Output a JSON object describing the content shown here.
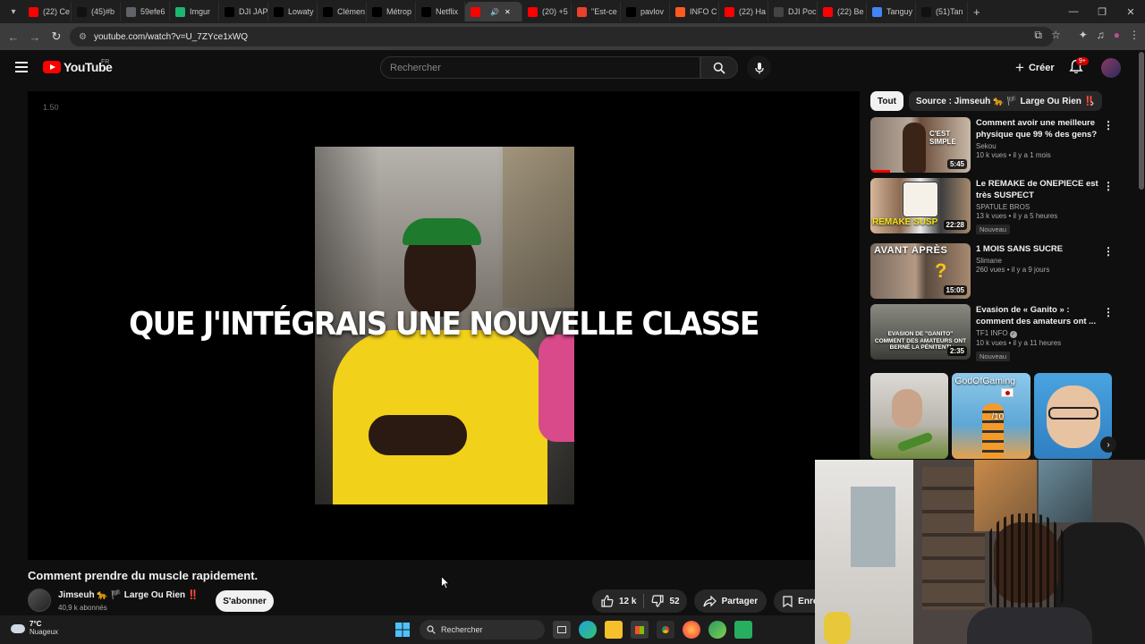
{
  "browser": {
    "tabs": [
      {
        "label": "(22) Ce",
        "fav_color": "#ff0000",
        "icon": "youtube-icon"
      },
      {
        "label": "(45)#b",
        "fav_color": "#111111",
        "icon": "tiktok-icon"
      },
      {
        "label": "59efe6",
        "fav_color": "#5f6368",
        "icon": "globe-icon"
      },
      {
        "label": "Imgur",
        "fav_color": "#1bb76e",
        "icon": "imgur-icon"
      },
      {
        "label": "DJI JAP",
        "fav_color": "#000000",
        "icon": "x-icon"
      },
      {
        "label": "Lowaty",
        "fav_color": "#000000",
        "icon": "x-icon"
      },
      {
        "label": "Clémen",
        "fav_color": "#000000",
        "icon": "x-icon"
      },
      {
        "label": "Métrop",
        "fav_color": "#000000",
        "icon": "x-icon"
      },
      {
        "label": "Netflix",
        "fav_color": "#000000",
        "icon": "x-icon"
      },
      {
        "label": "",
        "fav_color": "#ff0000",
        "icon": "youtube-icon",
        "active": true
      },
      {
        "label": "(20) +5",
        "fav_color": "#ff0000",
        "icon": "youtube-icon"
      },
      {
        "label": "\"Est-ce",
        "fav_color": "#e8412c",
        "icon": "e-icon"
      },
      {
        "label": "pavlov",
        "fav_color": "#000000",
        "icon": "x-icon"
      },
      {
        "label": "INFO C",
        "fav_color": "#ff5a1f",
        "icon": "rss-icon"
      },
      {
        "label": "(22) Ha",
        "fav_color": "#ff0000",
        "icon": "youtube-icon"
      },
      {
        "label": "DJI Poc",
        "fav_color": "#444444",
        "icon": "dji-icon"
      },
      {
        "label": "(22) Be",
        "fav_color": "#ff0000",
        "icon": "youtube-icon"
      },
      {
        "label": "Tanguy",
        "fav_color": "#4285f4",
        "icon": "google-icon"
      },
      {
        "label": "(51)Tan",
        "fav_color": "#111111",
        "icon": "tiktok-icon"
      }
    ],
    "new_tab": "+",
    "url": "youtube.com/watch?v=U_7ZYce1xWQ"
  },
  "header": {
    "logo_text": "YouTube",
    "region": "FR",
    "search_placeholder": "Rechercher",
    "create_label": "Créer",
    "notif_badge": "9+"
  },
  "player": {
    "speed_label": "1.50",
    "caption": "QUE J'INTÉGRAIS UNE NOUVELLE CLASSE"
  },
  "video": {
    "title": "Comment prendre du muscle rapidement.",
    "channel": "Jimseuh 🐆 🏴 Large Ou Rien ‼️",
    "subscribers": "40,9 k abonnés",
    "subscribe_label": "S'abonner",
    "likes": "12 k",
    "dislikes": "52",
    "share_label": "Partager",
    "save_label": "Enregist"
  },
  "sidebar": {
    "chips": [
      {
        "label": "Tout",
        "selected": true
      },
      {
        "label": "Source : Jimseuh 🐆 🏴 Large Ou Rien ‼️",
        "selected": false
      }
    ],
    "recommendations": [
      {
        "title": "Comment avoir une meilleure physique que 99 % des gens?",
        "channel": "Sekou",
        "meta": "10 k vues • il y a 1 mois",
        "duration": "5:45",
        "badge": "",
        "thumb_text": "C'EST SIMPLE",
        "watched": 0.2
      },
      {
        "title": "Le REMAKE de ONEPIECE est très SUSPECT",
        "channel": "SPATULE BROS",
        "meta": "13 k vues • il y a 5 heures",
        "duration": "22:28",
        "badge": "Nouveau",
        "thumb_text": "REMAKE SUSP"
      },
      {
        "title": "1 MOIS SANS SUCRE",
        "channel": "Slimane",
        "meta": "260 vues • il y a 9 jours",
        "duration": "15:05",
        "badge": "",
        "thumb_text": "AVANT APRÈS"
      },
      {
        "title": "Evasion de « Ganito » : comment des amateurs ont ...",
        "channel": "TF1 INFO",
        "meta": "10 k vues • il y a 11 heures",
        "duration": "2:35",
        "badge": "Nouveau",
        "thumb_text": "EVASION DE \"GANITO\" COMMENT DES AMATEURS ONT BERNÉ LA PÉNITENTI"
      }
    ],
    "shorts": [
      {
        "overlay": ""
      },
      {
        "overlay": "GodOfGaming"
      },
      {
        "overlay": ""
      }
    ],
    "shorts_extra": "/10"
  },
  "taskbar": {
    "temperature": "7°C",
    "condition": "Nuageux",
    "search_label": "Rechercher"
  }
}
